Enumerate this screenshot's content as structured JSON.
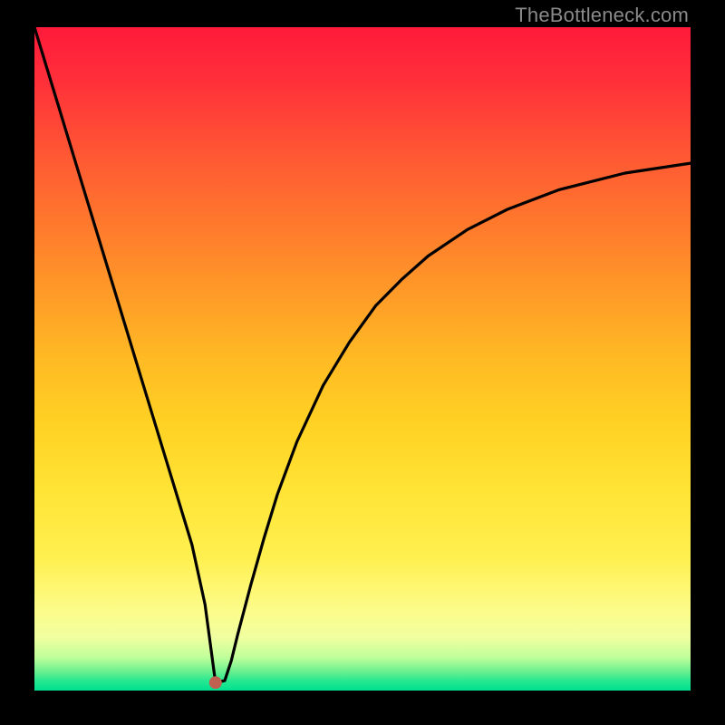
{
  "watermark": "TheBottleneck.com",
  "chart_data": {
    "type": "line",
    "title": "",
    "xlabel": "",
    "ylabel": "",
    "xlim": [
      0,
      100
    ],
    "ylim": [
      0,
      100
    ],
    "background_gradient": {
      "top": "#ff1a3a",
      "bottom": "#00e090",
      "meaning": "red=high bottleneck, green=optimal"
    },
    "series": [
      {
        "name": "bottleneck-curve",
        "color": "#000000",
        "x": [
          0,
          2,
          4,
          6,
          8,
          10,
          12,
          14,
          16,
          18,
          20,
          22,
          24,
          26,
          27.6,
          29,
          30,
          31,
          33,
          35,
          37,
          40,
          44,
          48,
          52,
          56,
          60,
          66,
          72,
          80,
          90,
          100
        ],
        "y": [
          100,
          93.5,
          87,
          80.5,
          74,
          67.5,
          61,
          54.5,
          48,
          41.5,
          35,
          28.5,
          22,
          13,
          1.2,
          1.5,
          4.5,
          8.5,
          16,
          23,
          29.5,
          37.5,
          46,
          52.5,
          58,
          62,
          65.5,
          69.5,
          72.5,
          75.5,
          78,
          79.5
        ]
      }
    ],
    "marker": {
      "x": 27.6,
      "y": 1.2,
      "color": "#c06050",
      "radius_px": 7
    }
  }
}
